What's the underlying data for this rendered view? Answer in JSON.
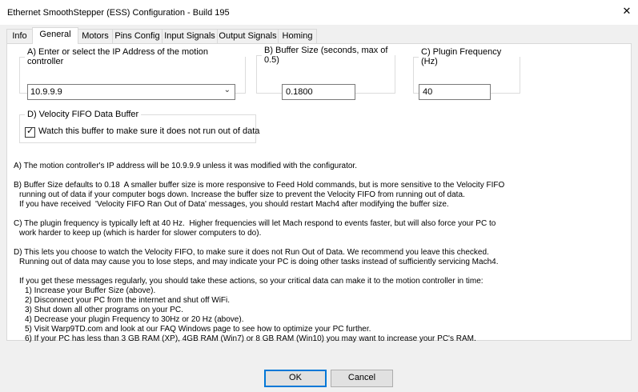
{
  "window": {
    "title": "Ethernet SmoothStepper (ESS) Configuration - Build 195",
    "close_glyph": "✕"
  },
  "tabs": [
    {
      "label": "Info"
    },
    {
      "label": "General",
      "active": true
    },
    {
      "label": "Motors"
    },
    {
      "label": "Pins Config"
    },
    {
      "label": "Input Signals"
    },
    {
      "label": "Output Signals"
    },
    {
      "label": "Homing"
    }
  ],
  "ip": {
    "legend": "A) Enter or select the IP Address of the motion controller",
    "value": "10.9.9.9"
  },
  "buffer": {
    "legend": "B) Buffer Size (seconds, max of 0.5)",
    "value": "0.1800"
  },
  "plugin": {
    "legend": "C) Plugin Frequency (Hz)",
    "value": "40"
  },
  "fifo": {
    "legend": "D) Velocity FIFO Data Buffer",
    "checkbox_label": "Watch this buffer to make sure it does not run out of data",
    "checked": true
  },
  "help": {
    "a": "A) The motion controller's IP address will be 10.9.9.9 unless it was modified with the configurator.",
    "b1": "B) Buffer Size defaults to 0.18  A smaller buffer size is more responsive to Feed Hold commands, but is more sensitive to the Velocity FIFO",
    "b2": "running out of data if your computer bogs down. Increase the buffer size to prevent the Velocity FIFO from running out of data.",
    "b3": "If you have received  'Velocity FIFO Ran Out of Data' messages, you should restart Mach4 after modifying the buffer size.",
    "c1": "C) The plugin frequency is typically left at 40 Hz.  Higher frequencies will let Mach respond to events faster, but will also force your PC to",
    "c2": "work harder to keep up (which is harder for slower computers to do).",
    "d1": "D) This lets you choose to watch the Velocity FIFO, to make sure it does not Run Out of Data. We recommend you leave this checked.",
    "d2": "Running out of data may cause you to lose steps, and may indicate your PC is doing other tasks instead of sufficiently servicing Mach4.",
    "e": "If you get these messages regularly, you should take these actions, so your critical data can make it to the motion controller in time:",
    "steps": [
      "1) Increase your Buffer Size (above).",
      "2) Disconnect your PC from the internet and shut off WiFi.",
      "3) Shut down all other programs on your PC.",
      "4) Decrease your plugin Frequency to 30Hz or 20 Hz (above).",
      "5) Visit Warp9TD.com and look at our FAQ Windows page to see how to optimize your PC further.",
      "6) If your PC has less than 3 GB RAM (XP), 4GB RAM (Win7) or 8 GB RAM (Win10) you may want to increase your PC's RAM."
    ]
  },
  "buttons": {
    "ok": "OK",
    "cancel": "Cancel"
  }
}
